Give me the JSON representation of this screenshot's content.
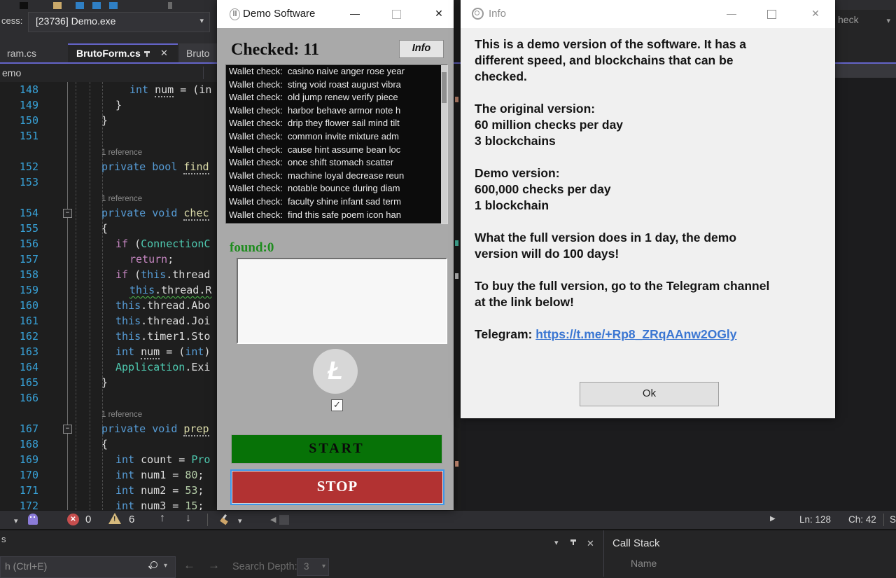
{
  "icons": {
    "minimize": "—",
    "close": "✕",
    "caret_down": "▾",
    "arrow_up": "↑",
    "arrow_down": "↓",
    "arrow_left": "←",
    "arrow_right": "→",
    "collapse_left": "◀",
    "run_right": "▶",
    "check": "✓",
    "litecoin": "Ł",
    "fold_minus": "−",
    "toolbar_chevron": "❯"
  },
  "accents": {
    "purple_debug": "#6464c8",
    "error_red": "#c74e4e",
    "warning_yellow": "#d7ba7d",
    "found_green": "#1e8c1e",
    "start_green": "#077207",
    "stop_red": "#b23232",
    "link_blue": "#3a76d2"
  },
  "ide": {
    "process": {
      "label": "cess:",
      "value": "[23736] Demo.exe"
    },
    "tabs": [
      {
        "label": "ram.cs"
      },
      {
        "label": "BrutoForm.cs"
      },
      {
        "label": "Bruto"
      }
    ],
    "breadcrumb": "emo",
    "top_right_dropdown": "heck",
    "code": {
      "rows": [
        {
          "num": "148",
          "indent": 2,
          "segs": [
            [
              "kw",
              "int "
            ],
            [
              "dot",
              "num"
            ],
            [
              "pl",
              " = (in"
            ]
          ]
        },
        {
          "num": "149",
          "indent": 1,
          "segs": [
            [
              "pl",
              "}"
            ]
          ]
        },
        {
          "num": "150",
          "indent": 0,
          "segs": [
            [
              "pl",
              "}"
            ]
          ]
        },
        {
          "num": "151",
          "indent": 0,
          "segs": []
        },
        {
          "ref": "1 reference",
          "indent": 0
        },
        {
          "num": "152",
          "indent": 0,
          "segs": [
            [
              "kw",
              "private bool "
            ],
            [
              "dotm",
              "find"
            ]
          ]
        },
        {
          "num": "153",
          "indent": 0,
          "segs": []
        },
        {
          "ref": "1 reference",
          "indent": 0
        },
        {
          "num": "154",
          "indent": 0,
          "fold": true,
          "segs": [
            [
              "kw",
              "private void "
            ],
            [
              "dotm",
              "chec"
            ]
          ]
        },
        {
          "num": "155",
          "indent": 0,
          "segs": [
            [
              "pl",
              "{"
            ]
          ]
        },
        {
          "num": "156",
          "indent": 1,
          "segs": [
            [
              "ctrl",
              "if"
            ],
            [
              "pl",
              " ("
            ],
            [
              "type",
              "ConnectionC"
            ]
          ]
        },
        {
          "num": "157",
          "indent": 2,
          "segs": [
            [
              "ctrl",
              "return"
            ],
            [
              "pl",
              ";"
            ]
          ]
        },
        {
          "num": "158",
          "indent": 1,
          "segs": [
            [
              "ctrl",
              "if"
            ],
            [
              "pl",
              " ("
            ],
            [
              "kw",
              "this"
            ],
            [
              "pl",
              ".thread"
            ]
          ]
        },
        {
          "num": "159",
          "indent": 2,
          "squiggle": true,
          "segs": [
            [
              "kw",
              "this"
            ],
            [
              "pl",
              ".thread.R"
            ]
          ]
        },
        {
          "num": "160",
          "indent": 1,
          "segs": [
            [
              "kw",
              "this"
            ],
            [
              "pl",
              ".thread.Abo"
            ]
          ]
        },
        {
          "num": "161",
          "indent": 1,
          "segs": [
            [
              "kw",
              "this"
            ],
            [
              "pl",
              ".thread.Joi"
            ]
          ]
        },
        {
          "num": "162",
          "indent": 1,
          "segs": [
            [
              "kw",
              "this"
            ],
            [
              "pl",
              ".timer1.Sto"
            ]
          ]
        },
        {
          "num": "163",
          "indent": 1,
          "segs": [
            [
              "kw",
              "int "
            ],
            [
              "dot",
              "num"
            ],
            [
              "pl",
              " = ("
            ],
            [
              "kw",
              "int"
            ],
            [
              "pl",
              ")"
            ]
          ]
        },
        {
          "num": "164",
          "indent": 1,
          "segs": [
            [
              "type",
              "Application"
            ],
            [
              "pl",
              ".Exi"
            ]
          ]
        },
        {
          "num": "165",
          "indent": 0,
          "segs": [
            [
              "pl",
              "}"
            ]
          ]
        },
        {
          "num": "166",
          "indent": 0,
          "segs": []
        },
        {
          "ref": "1 reference",
          "indent": 0
        },
        {
          "num": "167",
          "indent": 0,
          "fold": true,
          "segs": [
            [
              "kw",
              "private void "
            ],
            [
              "dotm",
              "prep"
            ]
          ]
        },
        {
          "num": "168",
          "indent": 0,
          "segs": [
            [
              "pl",
              "{"
            ]
          ]
        },
        {
          "num": "169",
          "indent": 1,
          "segs": [
            [
              "kw",
              "int "
            ],
            [
              "pl",
              "count = "
            ],
            [
              "type",
              "Pro"
            ]
          ]
        },
        {
          "num": "170",
          "indent": 1,
          "segs": [
            [
              "kw",
              "int "
            ],
            [
              "pl",
              "num1 = "
            ],
            [
              "numlit",
              "80"
            ],
            [
              "pl",
              ";"
            ]
          ]
        },
        {
          "num": "171",
          "indent": 1,
          "segs": [
            [
              "kw",
              "int "
            ],
            [
              "pl",
              "num2 = "
            ],
            [
              "numlit",
              "53"
            ],
            [
              "pl",
              ";"
            ]
          ]
        },
        {
          "num": "172",
          "indent": 1,
          "segs": [
            [
              "kw",
              "int "
            ],
            [
              "pl",
              "num3 = "
            ],
            [
              "numlit",
              "15"
            ],
            [
              "pl",
              ";"
            ]
          ]
        }
      ]
    },
    "status_bar": {
      "error_count": "0",
      "warning_count": "6",
      "line": "Ln: 128",
      "column": "Ch: 42",
      "right_partial": "S"
    },
    "bottom_panel": {
      "left_partial": "s",
      "search_value": "h (Ctrl+E)",
      "nav_label": "Search Depth:",
      "nav_value": "3",
      "callstack_title": "Call Stack",
      "callstack_column": "Name"
    }
  },
  "demo_window": {
    "title": "Demo Software",
    "checked_label": "Checked: 11",
    "info_button": "Info",
    "wallet_prefix": "Wallet check:",
    "wallet_items": [
      "casino naive anger rose year",
      "sting void roast august vibra",
      "old jump renew verify piece",
      "harbor behave armor note h",
      "drip they flower sail mind tilt",
      "common invite mixture adm",
      "cause hint assume bean loc",
      "once shift stomach scatter",
      "machine loyal decrease reun",
      "notable bounce during diam",
      "faculty shine infant sad term",
      "find this safe poem icon han"
    ],
    "found_label": "found:0",
    "checkbox_checked": true,
    "start_button": "START",
    "stop_button": "STOP"
  },
  "info_window": {
    "title": "Info",
    "paragraphs": [
      "This is a demo version of the software. It has a\ndifferent speed, and blockchains that can be\nchecked.",
      "The original version:\n60 million checks per day\n3 blockchains",
      "Demo version:\n600,000 checks per day\n1 blockchain",
      "What the full version does in 1 day, the demo\nversion will do 100 days!",
      "To buy the full version, go to the Telegram channel\nat the link below!"
    ],
    "telegram_label": "Telegram: ",
    "telegram_link": "https://t.me/+Rp8_ZRqAAnw2OGly",
    "ok_button": "Ok"
  }
}
